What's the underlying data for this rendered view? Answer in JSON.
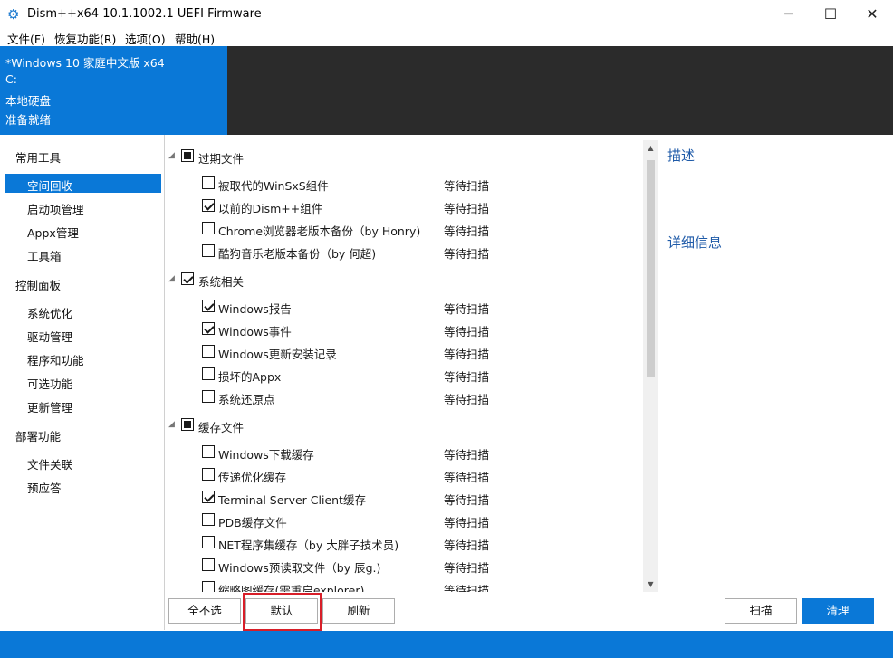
{
  "window": {
    "title": "Dism++x64 10.1.1002.1 UEFI Firmware",
    "icon": "gears-icon",
    "minimize": "─",
    "maximize": "☐",
    "close": "✕"
  },
  "menu": [
    "文件(F)",
    "恢复功能(R)",
    "选项(O)",
    "帮助(H)"
  ],
  "header": {
    "os": "*Windows 10 家庭中文版 x64",
    "drive": "C:",
    "disk": "本地硬盘",
    "status": "准备就绪"
  },
  "sidebar": {
    "groups": [
      {
        "label": "常用工具",
        "items": [
          "空间回收",
          "启动项管理",
          "Appx管理",
          "工具箱"
        ]
      },
      {
        "label": "控制面板",
        "items": [
          "系统优化",
          "驱动管理",
          "程序和功能",
          "可选功能",
          "更新管理"
        ]
      },
      {
        "label": "部署功能",
        "items": [
          "文件关联",
          "预应答"
        ]
      }
    ],
    "selected": "空间回收"
  },
  "content": {
    "groups": [
      {
        "label": "过期文件",
        "state": "partial",
        "items": [
          {
            "label": "被取代的WinSxS组件",
            "checked": false,
            "status": "等待扫描"
          },
          {
            "label": "以前的Dism++组件",
            "checked": true,
            "status": "等待扫描"
          },
          {
            "label": "Chrome浏览器老版本备份（by Honry)",
            "checked": false,
            "status": "等待扫描"
          },
          {
            "label": "酷狗音乐老版本备份（by 何超)",
            "checked": false,
            "status": "等待扫描"
          }
        ]
      },
      {
        "label": "系统相关",
        "state": "checked",
        "items": [
          {
            "label": "Windows报告",
            "checked": true,
            "status": "等待扫描"
          },
          {
            "label": "Windows事件",
            "checked": true,
            "status": "等待扫描"
          },
          {
            "label": "Windows更新安装记录",
            "checked": false,
            "status": "等待扫描"
          },
          {
            "label": "损坏的Appx",
            "checked": false,
            "status": "等待扫描"
          },
          {
            "label": "系统还原点",
            "checked": false,
            "status": "等待扫描"
          }
        ]
      },
      {
        "label": "缓存文件",
        "state": "partial",
        "items": [
          {
            "label": "Windows下载缓存",
            "checked": false,
            "status": "等待扫描"
          },
          {
            "label": "传递优化缓存",
            "checked": false,
            "status": "等待扫描"
          },
          {
            "label": "Terminal Server Client缓存",
            "checked": true,
            "status": "等待扫描"
          },
          {
            "label": "PDB缓存文件",
            "checked": false,
            "status": "等待扫描"
          },
          {
            "label": "NET程序集缓存（by 大胖子技术员)",
            "checked": false,
            "status": "等待扫描"
          },
          {
            "label": "Windows预读取文件（by 辰g.)",
            "checked": false,
            "status": "等待扫描"
          },
          {
            "label": "缩略图缓存(需重启explorer)",
            "checked": false,
            "status": "等待扫描"
          }
        ]
      }
    ]
  },
  "details": {
    "describe": "描述",
    "info": "详细信息"
  },
  "buttons": {
    "deselect_all": "全不选",
    "default": "默认",
    "refresh": "刷新",
    "scan": "扫描",
    "clean": "清理"
  },
  "colors": {
    "accent": "#0a78d7",
    "dark_header": "#2b2b2b",
    "highlight": "#d81e28"
  }
}
